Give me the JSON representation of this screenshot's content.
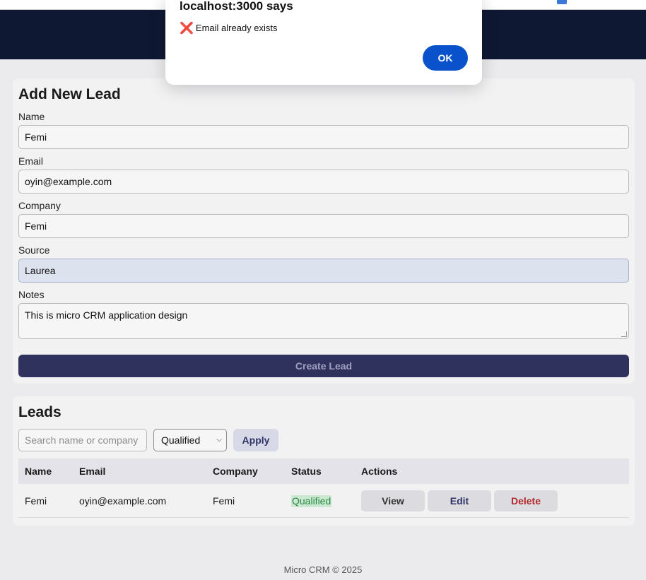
{
  "dialog": {
    "title": "localhost:3000 says",
    "message_icon": "❌",
    "message": "Email already exists",
    "ok_label": "OK"
  },
  "form": {
    "title": "Add New Lead",
    "name_label": "Name",
    "name_value": "Femi",
    "email_label": "Email",
    "email_value": "oyin@example.com",
    "company_label": "Company",
    "company_value": "Femi",
    "source_label": "Source",
    "source_value": "Laurea",
    "notes_label": "Notes",
    "notes_value": "This is micro CRM application design",
    "submit_label": "Create Lead"
  },
  "leads": {
    "title": "Leads",
    "search_placeholder": "Search name or company",
    "status_filter": "Qualified",
    "apply_label": "Apply",
    "columns": [
      "Name",
      "Email",
      "Company",
      "Status",
      "Actions"
    ],
    "rows": [
      {
        "name": "Femi",
        "email": "oyin@example.com",
        "company": "Femi",
        "status": "Qualified",
        "actions": [
          "View",
          "Edit",
          "Delete"
        ]
      }
    ]
  },
  "footer": {
    "text": "Micro CRM © 2025"
  },
  "colors": {
    "header_bg": "#0f1833",
    "primary_button": "#30325e",
    "dialog_ok": "#0a52cc",
    "status_qualified": "#2b8a43",
    "delete_text": "#b3282d"
  }
}
